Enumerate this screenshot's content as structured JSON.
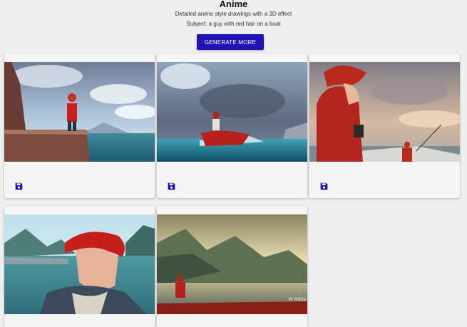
{
  "header": {
    "title": "Anime",
    "description": "Detailed anime style drawings with a 3D effect",
    "subject": "Subject: a guy with red hair on a boat",
    "generate_button_label": "GENERATE MORE"
  },
  "colors": {
    "background": "#efefef",
    "accent": "#2313b5",
    "card": "#f5f5f5",
    "save_icon": "#1a12a8"
  },
  "gallery": {
    "images": [
      {
        "alt": "anime-guy-red-hair-cliff-sea",
        "has_save": true
      },
      {
        "alt": "anime-guy-red-hair-boat-storm",
        "has_save": true
      },
      {
        "alt": "anime-guy-red-hair-fishing-boat",
        "has_save": true
      },
      {
        "alt": "anime-guy-red-hair-windblown-bay",
        "has_save": false
      },
      {
        "alt": "anime-guy-red-hair-boat-mountains",
        "has_save": false
      }
    ],
    "save_icon": "floppy-disk-icon",
    "watermark": "W W$Ga"
  }
}
